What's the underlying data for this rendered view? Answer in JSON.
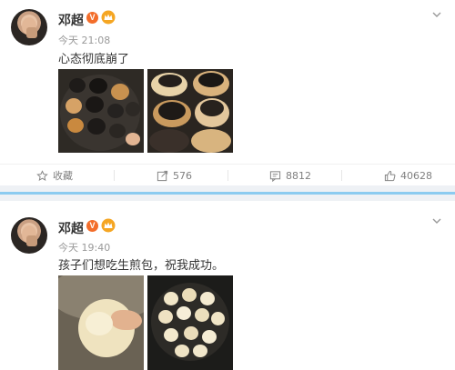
{
  "posts": [
    {
      "author": "邓超",
      "verified_badge": "V",
      "time": "今天 21:08",
      "text": "心态彻底崩了",
      "images": [
        "burnt-buns-in-pan",
        "burnt-buns-closeup"
      ],
      "actions": {
        "favorite_label": "收藏",
        "repost_count": "576",
        "comment_count": "8812",
        "like_count": "40628"
      }
    },
    {
      "author": "邓超",
      "verified_badge": "V",
      "time": "今天 19:40",
      "text": "孩子们想吃生煎包，祝我成功。",
      "images": [
        "dough-kneading",
        "raw-buns-in-pan"
      ]
    }
  ],
  "colors": {
    "accent": "#f36d2a",
    "divider_blue": "#8ccbf0",
    "muted": "#999999"
  },
  "icons": [
    "chevron-down-icon",
    "star-icon",
    "share-icon",
    "comment-icon",
    "thumbs-up-icon",
    "crown-icon"
  ]
}
